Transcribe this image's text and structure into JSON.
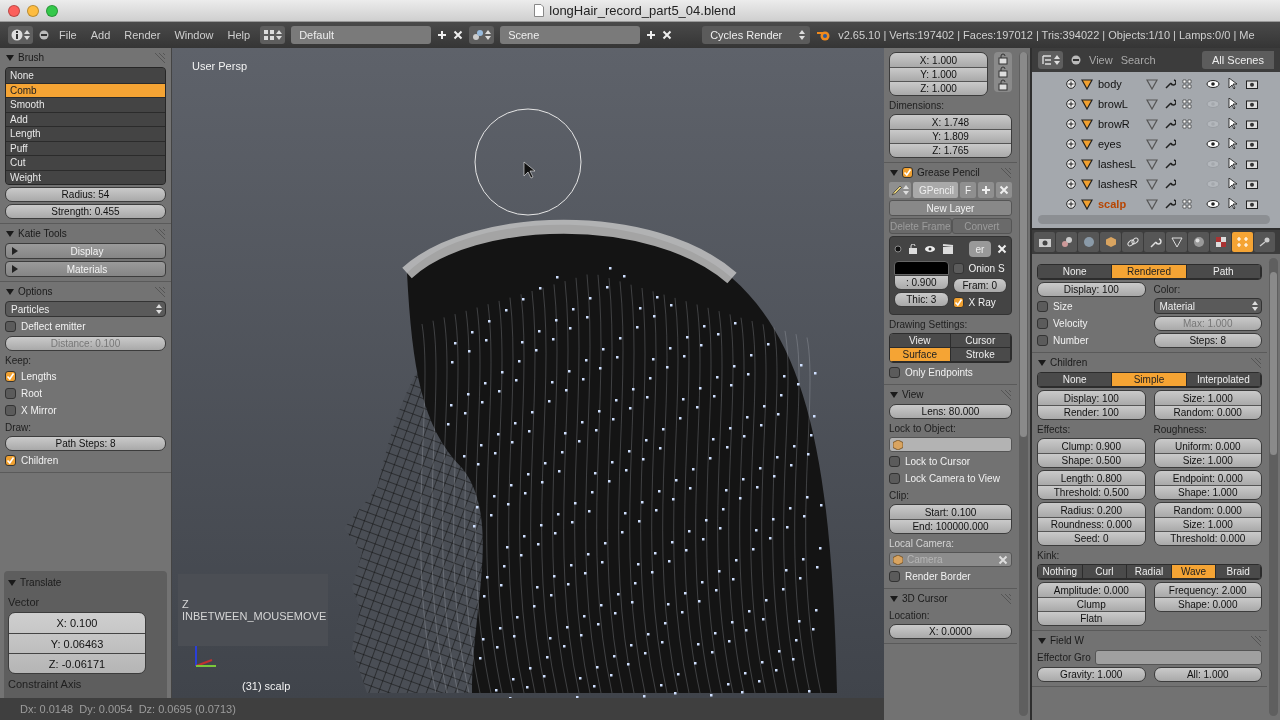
{
  "title_bar": {
    "title": "longHair_record_part5_04.blend"
  },
  "menu_bar": {
    "menus": [
      "File",
      "Add",
      "Render",
      "Window",
      "Help"
    ],
    "layout": "Default",
    "scene": "Scene",
    "engine": "Cycles Render",
    "stats": "v2.65.10 | Verts:197402 | Faces:197012 | Tris:394022 | Objects:1/10 | Lamps:0/0 | Me"
  },
  "tool_shelf": {
    "panels": [
      {
        "title": "Brush",
        "expanded": true,
        "items": [
          {
            "kind": "list",
            "options": [
              {
                "label": "None",
                "selected": false
              },
              {
                "label": "Comb",
                "selected": true
              },
              {
                "label": "Smooth",
                "selected": false
              },
              {
                "label": "Add",
                "selected": false
              },
              {
                "label": "Length",
                "selected": false
              },
              {
                "label": "Puff",
                "selected": false
              },
              {
                "label": "Cut",
                "selected": false
              },
              {
                "label": "Weight",
                "selected": false
              }
            ]
          },
          {
            "kind": "field",
            "text": "Radius: 54",
            "disabled": false
          },
          {
            "kind": "field",
            "text": "Strength: 0.455",
            "disabled": false
          }
        ]
      },
      {
        "title": "Katie Tools",
        "expanded": true,
        "items": [
          {
            "kind": "button",
            "text": "Display"
          },
          {
            "kind": "button",
            "text": "Materials"
          }
        ]
      },
      {
        "title": "Options",
        "expanded": true,
        "items": [
          {
            "kind": "dropdown",
            "text": "Particles"
          },
          {
            "kind": "check",
            "label": "Deflect emitter",
            "checked": false
          },
          {
            "kind": "field",
            "text": "Distance: 0.100",
            "disabled": true
          },
          {
            "kind": "label",
            "text": "Keep:"
          },
          {
            "kind": "check",
            "label": "Lengths",
            "checked": true
          },
          {
            "kind": "check",
            "label": "Root",
            "checked": false
          },
          {
            "kind": "check",
            "label": "X Mirror",
            "checked": false
          },
          {
            "kind": "label",
            "text": "Draw:"
          },
          {
            "kind": "field",
            "text": "Path Steps: 8",
            "disabled": false
          },
          {
            "kind": "check",
            "label": "Children",
            "checked": true
          }
        ]
      }
    ],
    "operator": {
      "title": "Translate",
      "expanded": true,
      "label": "Vector",
      "fields": [
        "X: 0.100",
        "Y: 0.06463",
        "Z: -0.06171"
      ],
      "footer": "Constraint Axis"
    }
  },
  "viewport": {
    "view_label": "User Persp",
    "object_label": "(31) scalp",
    "event_overlay": [
      "Z",
      "INBETWEEN_MOUSEMOVE"
    ]
  },
  "status_bar": {
    "text": "Dx: 0.0148  Dy: 0.0054  Dz: 0.0695 (0.0713)"
  },
  "properties_region": {
    "panels": [
      {
        "items": [
          {
            "kind": "lock_fields",
            "fields": [
              "X: 1.000",
              "Y: 1.000",
              "Z: 1.000"
            ]
          },
          {
            "kind": "label",
            "text": "Dimensions:"
          },
          {
            "kind": "fields",
            "fields": [
              "X: 1.748",
              "Y: 1.809",
              "Z: 1.765"
            ]
          }
        ]
      },
      {
        "title": "Grease Pencil",
        "expanded": true,
        "checked": true,
        "items": [
          {
            "kind": "gp_row",
            "name": "GPencil",
            "flag": "F"
          },
          {
            "kind": "buttons",
            "options": [
              {
                "label": "New Layer",
                "disabled": false
              }
            ]
          },
          {
            "kind": "buttons",
            "options": [
              {
                "label": "Delete Frame",
                "disabled": true
              },
              {
                "label": "Convert",
                "disabled": true
              }
            ]
          },
          {
            "kind": "gp_layer",
            "name": "er",
            "opacity": ": 0.900",
            "thickness": "Thic: 3",
            "frame": "Fram: 0",
            "onion": {
              "label": "Onion S",
              "checked": false
            },
            "xray": {
              "label": "X Ray",
              "checked": true
            }
          },
          {
            "kind": "label",
            "text": "Drawing Settings:"
          },
          {
            "kind": "segmented",
            "options": [
              {
                "label": "View",
                "selected": false
              },
              {
                "label": "Cursor",
                "selected": false
              },
              {
                "label": "Surface",
                "selected": true
              },
              {
                "label": "Stroke",
                "selected": false
              }
            ]
          },
          {
            "kind": "check",
            "label": "Only Endpoints",
            "checked": false
          }
        ]
      },
      {
        "title": "View",
        "expanded": true,
        "items": [
          {
            "kind": "field",
            "text": "Lens: 80.000",
            "disabled": false
          },
          {
            "kind": "label",
            "text": "Lock to Object:"
          },
          {
            "kind": "object_field",
            "disabled": false
          },
          {
            "kind": "check",
            "label": "Lock to Cursor",
            "checked": false
          },
          {
            "kind": "check",
            "label": "Lock Camera to View",
            "checked": false
          },
          {
            "kind": "label",
            "text": "Clip:"
          },
          {
            "kind": "fields",
            "fields": [
              "Start: 0.100",
              "End: 100000.000"
            ]
          },
          {
            "kind": "label",
            "text": "Local Camera:",
            "dim": true
          },
          {
            "kind": "object_field",
            "text": "Camera",
            "disabled": true,
            "clearable": true
          },
          {
            "kind": "check",
            "label": "Render Border",
            "checked": false
          }
        ]
      },
      {
        "title": "3D Cursor",
        "expanded": true,
        "items": [
          {
            "kind": "label",
            "text": "Location:"
          },
          {
            "kind": "field",
            "text": "X: 0.0000",
            "disabled": false
          }
        ]
      }
    ]
  },
  "outliner": {
    "menus": [
      "View",
      "Search"
    ],
    "filter": "All Scenes",
    "rows": [
      {
        "name": "body",
        "visible": true,
        "active": false,
        "particles": true
      },
      {
        "name": "browL",
        "visible": false,
        "active": false,
        "particles": true
      },
      {
        "name": "browR",
        "visible": false,
        "active": false,
        "particles": true
      },
      {
        "name": "eyes",
        "visible": true,
        "active": false,
        "particles": false
      },
      {
        "name": "lashesL",
        "visible": false,
        "active": false,
        "particles": false
      },
      {
        "name": "lashesR",
        "visible": false,
        "active": false,
        "particles": false
      },
      {
        "name": "scalp",
        "visible": true,
        "active": true,
        "particles": true
      }
    ]
  },
  "properties": {
    "tabs": [
      {
        "kind": "render",
        "selected": false
      },
      {
        "kind": "scene",
        "selected": false
      },
      {
        "kind": "world",
        "selected": false
      },
      {
        "kind": "object",
        "selected": false
      },
      {
        "kind": "constraints",
        "selected": false
      },
      {
        "kind": "modifiers",
        "selected": false
      },
      {
        "kind": "data",
        "selected": false
      },
      {
        "kind": "material",
        "selected": false
      },
      {
        "kind": "texture",
        "selected": false
      },
      {
        "kind": "particles",
        "selected": true
      },
      {
        "kind": "physics",
        "selected": false
      }
    ],
    "panels": [
      {
        "items": [
          {
            "kind": "segmented",
            "options": [
              {
                "label": "None",
                "selected": false
              },
              {
                "label": "Rendered",
                "selected": true
              },
              {
                "label": "Path",
                "selected": false
              }
            ]
          },
          {
            "kind": "columns",
            "left": [
              {
                "kind": "field",
                "text": "Display: 100",
                "disabled": false
              },
              {
                "kind": "check",
                "label": "Size",
                "checked": false
              },
              {
                "kind": "check",
                "label": "Velocity",
                "checked": false
              },
              {
                "kind": "check",
                "label": "Number",
                "checked": false
              }
            ],
            "right": [
              {
                "kind": "label",
                "text": "Color:"
              },
              {
                "kind": "dropdown",
                "text": "Material"
              },
              {
                "kind": "field",
                "text": "Max: 1.000",
                "disabled": true
              },
              {
                "kind": "field",
                "text": "Steps: 8",
                "disabled": false
              }
            ]
          }
        ]
      },
      {
        "title": "Children",
        "expanded": true,
        "items": [
          {
            "kind": "segmented",
            "options": [
              {
                "label": "None",
                "selected": false
              },
              {
                "label": "Simple",
                "selected": true
              },
              {
                "label": "Interpolated",
                "selected": false
              }
            ]
          },
          {
            "kind": "columns",
            "left": [
              {
                "kind": "fields",
                "fields": [
                  "Display: 100",
                  "Render: 100"
                ]
              }
            ],
            "right": [
              {
                "kind": "fields",
                "fields": [
                  "Size: 1.000",
                  "Random: 0.000"
                ]
              }
            ]
          },
          {
            "kind": "columns",
            "left": [
              {
                "kind": "label",
                "text": "Effects:"
              },
              {
                "kind": "fields",
                "fields": [
                  "Clump: 0.900",
                  "Shape: 0.500"
                ]
              },
              {
                "kind": "fields",
                "fields": [
                  "Length: 0.800",
                  "Threshold: 0.500"
                ]
              },
              {
                "kind": "fields",
                "fields": [
                  "Radius: 0.200",
                  "Roundness: 0.000",
                  "Seed: 0"
                ]
              }
            ],
            "right": [
              {
                "kind": "label",
                "text": "Roughness:"
              },
              {
                "kind": "fields",
                "fields": [
                  "Uniform: 0.000",
                  "Size: 1.000"
                ]
              },
              {
                "kind": "fields",
                "fields": [
                  "Endpoint: 0.000",
                  "Shape: 1.000"
                ]
              },
              {
                "kind": "fields",
                "fields": [
                  "Random: 0.000",
                  "Size: 1.000",
                  "Threshold: 0.000"
                ]
              }
            ]
          },
          {
            "kind": "label",
            "text": "Kink:"
          },
          {
            "kind": "segmented",
            "options": [
              {
                "label": "Nothing",
                "selected": false
              },
              {
                "label": "Curl",
                "selected": false
              },
              {
                "label": "Radial",
                "selected": false
              },
              {
                "label": "Wave",
                "selected": true
              },
              {
                "label": "Braid",
                "selected": false
              }
            ]
          },
          {
            "kind": "columns",
            "left": [
              {
                "kind": "fields",
                "fields": [
                  "Amplitude: 0.000",
                  "Clump",
                  "Flatn"
                ]
              }
            ],
            "right": [
              {
                "kind": "fields",
                "fields": [
                  "Frequency: 2.000",
                  "Shape: 0.000"
                ]
              }
            ]
          }
        ]
      },
      {
        "title": "Field W",
        "expanded": true,
        "items": [
          {
            "kind": "label_field",
            "label": "Effector Gro"
          },
          {
            "kind": "columns",
            "left": [
              {
                "kind": "field",
                "text": "Gravity: 1.000",
                "disabled": false
              }
            ],
            "right": [
              {
                "kind": "field",
                "text": "All: 1.000",
                "disabled": false
              }
            ]
          }
        ]
      }
    ]
  }
}
